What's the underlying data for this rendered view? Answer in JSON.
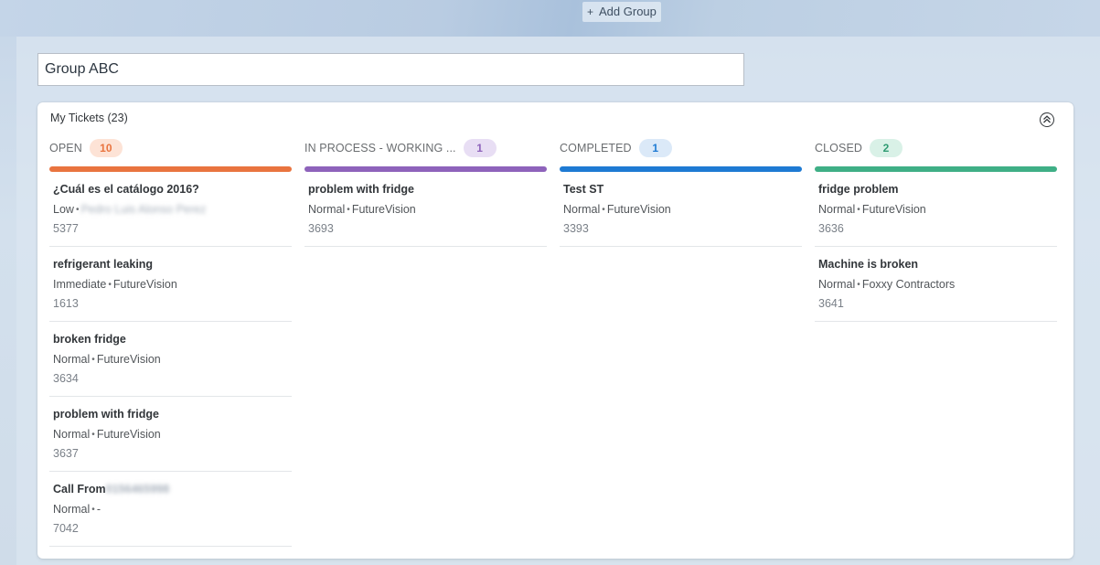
{
  "toolbar": {
    "add_group_icon": "+",
    "add_group_label": "Add Group"
  },
  "group": {
    "title_value": "Group ABC"
  },
  "card": {
    "title": "My Tickets (23)",
    "collapse_icon": "chevron-up-circle-icon"
  },
  "columns": [
    {
      "name": "OPEN",
      "count": "10",
      "color": "#e9743f",
      "badge_bg": "#fde3d6",
      "badge_fg": "#e9743f",
      "tickets": [
        {
          "title": "¿Cuál es el catálogo 2016?",
          "priority": "Low",
          "company": "Pedro Luis Alonso Perez",
          "company_blurred": true,
          "id": "5377"
        },
        {
          "title": "refrigerant leaking",
          "priority": "Immediate",
          "company": "FutureVision",
          "id": "1613"
        },
        {
          "title": "broken fridge",
          "priority": "Normal",
          "company": "FutureVision",
          "id": "3634"
        },
        {
          "title": "problem with fridge",
          "priority": "Normal",
          "company": "FutureVision",
          "id": "3637"
        },
        {
          "title": "Call From",
          "title_blurred_suffix": "0156465998",
          "priority": "Normal",
          "company": "-",
          "id": "7042"
        }
      ]
    },
    {
      "name": "IN PROCESS - WORKING ...",
      "count": "1",
      "color": "#8e63bb",
      "badge_bg": "#e8def4",
      "badge_fg": "#8e63bb",
      "tickets": [
        {
          "title": "problem with fridge",
          "priority": "Normal",
          "company": "FutureVision",
          "id": "3693"
        }
      ]
    },
    {
      "name": "COMPLETED",
      "count": "1",
      "color": "#1e7ad3",
      "badge_bg": "#dbe9f8",
      "badge_fg": "#1e7ad3",
      "tickets": [
        {
          "title": "Test ST",
          "priority": "Normal",
          "company": "FutureVision",
          "id": "3393"
        }
      ]
    },
    {
      "name": "CLOSED",
      "count": "2",
      "color": "#3faf86",
      "badge_bg": "#d9f1e7",
      "badge_fg": "#2f9b72",
      "tickets": [
        {
          "title": "fridge problem",
          "priority": "Normal",
          "company": "FutureVision",
          "id": "3636"
        },
        {
          "title": "Machine is broken",
          "priority": "Normal",
          "company": "Foxxy Contractors",
          "id": "3641"
        }
      ]
    }
  ]
}
